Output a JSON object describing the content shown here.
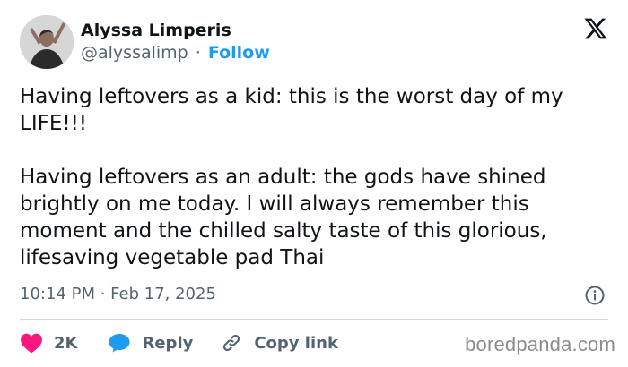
{
  "author": {
    "display_name": "Alyssa Limperis",
    "handle": "@alyssalimp",
    "separator": "·",
    "follow_label": "Follow"
  },
  "tweet": {
    "paragraphs": [
      "Having leftovers as a kid: this is the worst day of my LIFE!!!",
      "Having leftovers as an adult: the gods have shined brightly on me today. I will always remember this moment and the chilled salty taste of this glorious, lifesaving vegetable pad Thai"
    ],
    "timestamp": "10:14 PM · Feb 17, 2025"
  },
  "actions": {
    "like_count": "2K",
    "reply_label": "Reply",
    "copy_label": "Copy link"
  },
  "watermark": "boredpanda.com",
  "icons": {
    "platform": "x-logo-icon",
    "info": "info-icon",
    "like": "heart-icon",
    "reply": "speech-bubble-icon",
    "copy": "link-icon"
  },
  "colors": {
    "text": "#0f1419",
    "secondary": "#536471",
    "accent": "#1d9bf0",
    "like": "#f91880",
    "divider": "#cfd9de"
  }
}
